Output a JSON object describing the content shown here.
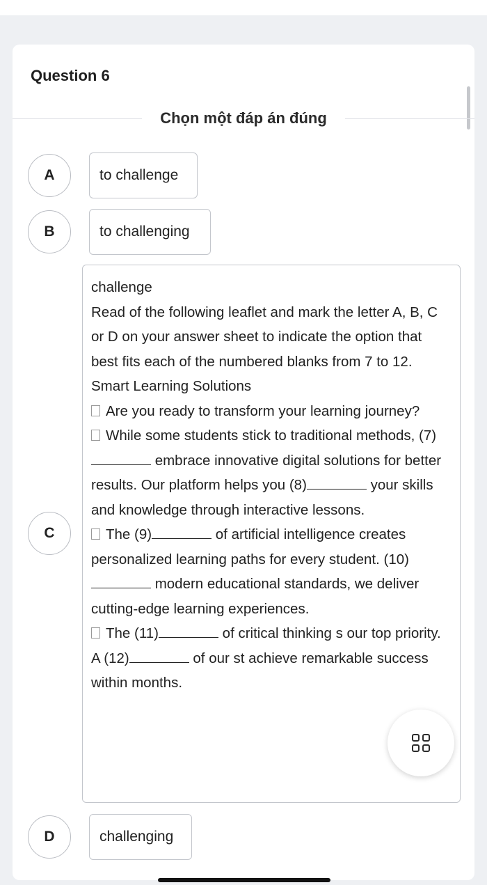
{
  "question": {
    "title": "Question 6",
    "instruction": "Chọn một đáp án đúng"
  },
  "options": [
    {
      "letter": "A",
      "text": "to challenge"
    },
    {
      "letter": "B",
      "text": "to challenging"
    },
    {
      "letter": "C",
      "lines": {
        "l1": "challenge",
        "l2": "Read of the following leaflet and mark the letter A, B, C or D on your answer sheet to indicate the option that best fits each of the numbered blanks from 7 to 12.",
        "l3": "Smart Learning Solutions",
        "l4": "Are you ready to transform your learning journey?",
        "l5a": "While some students stick to traditional methods, (7)",
        "l5b": " embrace innovative digital solutions for better results. Our platform helps you (8)",
        "l5c": " your skills and knowledge through interactive lessons.",
        "l6a": "The (9)",
        "l6b": " of artificial intelligence creates personalized learning paths for every student. (10)",
        "l6c": " modern educational standards, we deliver cutting-edge learning experiences.",
        "l7a": "The (11)",
        "l7b": " of critical thinking s",
        "l7c": " our top priority. A (12)",
        "l7d": " of our st",
        "l7e": " achieve remarkable success within months."
      }
    },
    {
      "letter": "D",
      "text": "challenging"
    }
  ],
  "float_button": {
    "icon": "grid-icon"
  }
}
